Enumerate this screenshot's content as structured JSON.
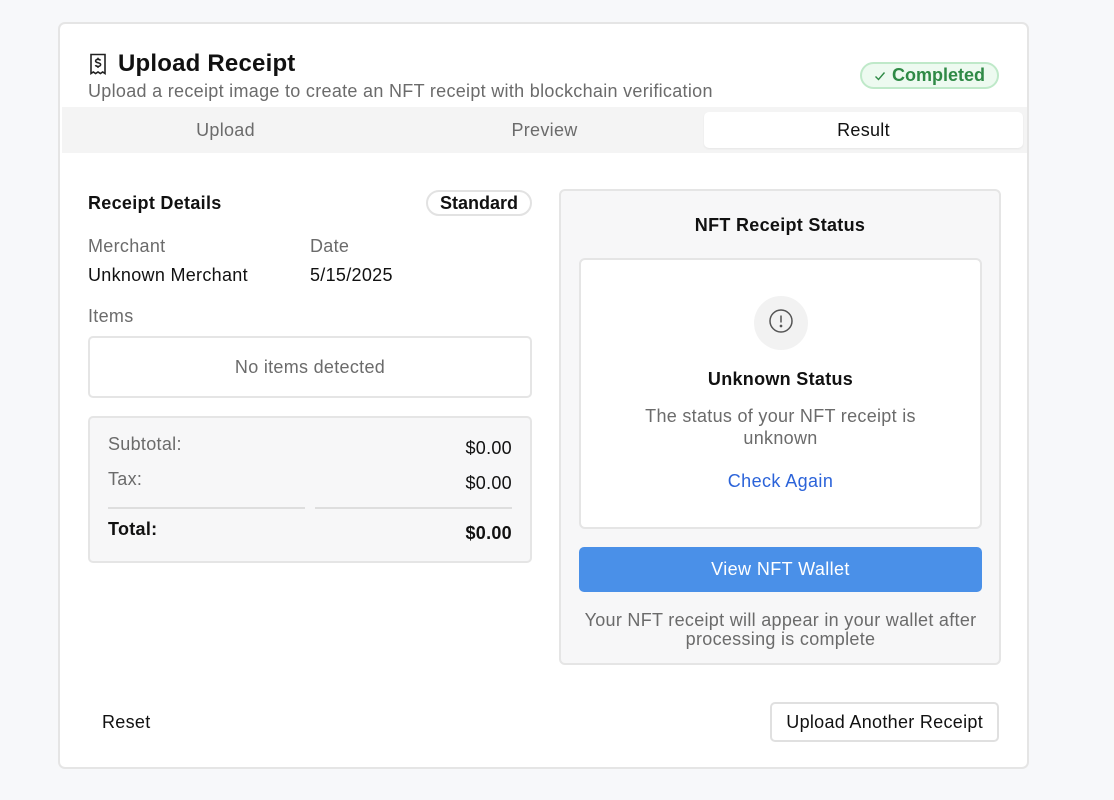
{
  "header": {
    "title": "Upload Receipt",
    "subtitle": "Upload a receipt image to create an NFT receipt with blockchain verification",
    "status_badge": "Completed",
    "title_icon": "receipt-dollar-icon"
  },
  "tabs": [
    {
      "label": "Upload",
      "active": false
    },
    {
      "label": "Preview",
      "active": false
    },
    {
      "label": "Result",
      "active": true
    }
  ],
  "receipt": {
    "section_title": "Receipt Details",
    "type_badge": "Standard",
    "merchant_label": "Merchant",
    "merchant_value": "Unknown Merchant",
    "date_label": "Date",
    "date_value": "5/15/2025",
    "items_label": "Items",
    "items_empty": "No items detected",
    "subtotal_label": "Subtotal:",
    "subtotal_value": "$0.00",
    "tax_label": "Tax:",
    "tax_value": "$0.00",
    "total_label": "Total:",
    "total_value": "$0.00"
  },
  "nft": {
    "title": "NFT Receipt Status",
    "status_icon": "alert-circle-icon",
    "status_name": "Unknown Status",
    "status_desc": "The status of your NFT receipt is unknown",
    "check_again": "Check Again",
    "wallet_button": "View NFT Wallet",
    "wallet_note": "Your NFT receipt will appear in your wallet after processing is complete"
  },
  "footer": {
    "reset": "Reset",
    "upload_another": "Upload Another Receipt"
  },
  "colors": {
    "accent": "#4a90e8",
    "link": "#2b63d9",
    "success": "#2f8a46"
  }
}
